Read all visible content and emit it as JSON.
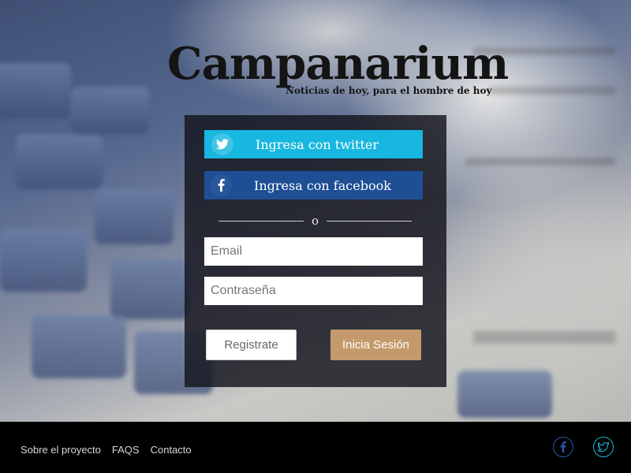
{
  "brand": {
    "title": "Campanarium",
    "tagline": "Noticias de hoy, para el hombre de hoy"
  },
  "login": {
    "twitter_label": "Ingresa con twitter",
    "facebook_label": "Ingresa con facebook",
    "divider_text": "o",
    "email_placeholder": "Email",
    "password_placeholder": "Contraseña",
    "register_label": "Registrate",
    "login_label": "Inicia Sesión"
  },
  "footer": {
    "links": [
      "Sobre el proyecto",
      "FAQS",
      "Contacto"
    ],
    "social_icons": [
      "facebook-icon",
      "twitter-icon"
    ]
  },
  "colors": {
    "twitter": "#17b7e0",
    "facebook": "#1e4f95",
    "login_button": "#c49a6c",
    "panel": "#14141c",
    "footer": "#000000"
  }
}
